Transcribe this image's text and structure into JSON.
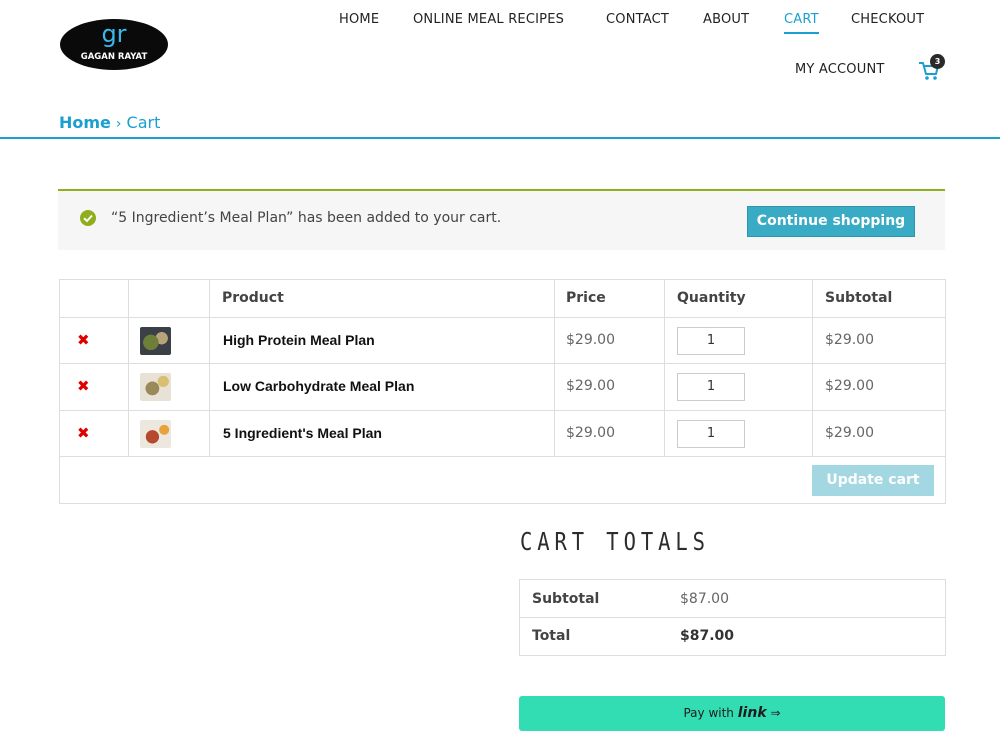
{
  "brand": {
    "logo_monogram": "gr",
    "logo_name": "GAGAN RAYAT"
  },
  "nav": {
    "items": [
      {
        "label": "HOME"
      },
      {
        "label": "ONLINE MEAL RECIPES"
      },
      {
        "label": "CONTACT"
      },
      {
        "label": "ABOUT"
      },
      {
        "label": "CART"
      },
      {
        "label": "CHECKOUT"
      },
      {
        "label": "MY ACCOUNT"
      }
    ],
    "active": "CART",
    "cart_count": "3",
    "cart_icon": "shopping-cart-icon"
  },
  "breadcrumb": {
    "home": "Home",
    "separator": "›",
    "current": "Cart"
  },
  "notice": {
    "icon": "check-circle-icon",
    "text": "“5 Ingredient’s Meal Plan” has been added to your cart.",
    "button": "Continue shopping"
  },
  "cart": {
    "headers": {
      "product": "Product",
      "price": "Price",
      "quantity": "Quantity",
      "subtotal": "Subtotal"
    },
    "remove_symbol": "✖",
    "items": [
      {
        "name": "High Protein Meal Plan",
        "price": "$29.00",
        "quantity": "1",
        "subtotal": "$29.00"
      },
      {
        "name": "Low Carbohydrate Meal Plan",
        "price": "$29.00",
        "quantity": "1",
        "subtotal": "$29.00"
      },
      {
        "name": "5 Ingredient's Meal Plan",
        "price": "$29.00",
        "quantity": "1",
        "subtotal": "$29.00"
      }
    ],
    "update_button": "Update cart"
  },
  "totals": {
    "title": "CART TOTALS",
    "subtotal_label": "Subtotal",
    "subtotal_value": "$87.00",
    "total_label": "Total",
    "total_value": "$87.00"
  },
  "pay": {
    "prefix": "Pay with",
    "brand": "link",
    "arrow": "⇒"
  },
  "colors": {
    "accent": "#1a9fd0",
    "success": "#8fae1b",
    "button": "#3aabc4",
    "pay": "#33ddb3",
    "remove": "#e00000"
  }
}
